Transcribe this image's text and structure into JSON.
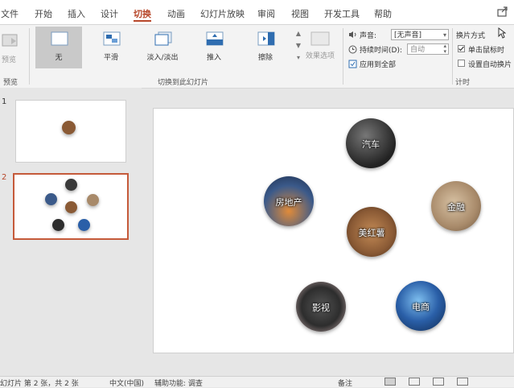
{
  "tabs": [
    "文件",
    "开始",
    "插入",
    "设计",
    "切换",
    "动画",
    "幻灯片放映",
    "审阅",
    "视图",
    "开发工具",
    "帮助"
  ],
  "active_tab": "切换",
  "ribbon": {
    "preview": {
      "label": "预览",
      "group": "预览"
    },
    "transitions": [
      "无",
      "平滑",
      "淡入/淡出",
      "推入",
      "擦除"
    ],
    "selected_transition": "无",
    "effect_options": "效果选项",
    "group_transitions": "切换到此幻灯片",
    "timing": {
      "sound_label": "声音:",
      "sound_value": "[无声音]",
      "duration_label": "持续时间(D):",
      "duration_value": "自动",
      "apply_all": "应用到全部",
      "advance_label": "换片方式",
      "on_click": "单击鼠标时",
      "auto_after": "设置自动换片",
      "group": "计时"
    }
  },
  "slides": [
    {
      "number": "1"
    },
    {
      "number": "2"
    }
  ],
  "canvas_circles": [
    {
      "label": "汽车",
      "color": "#3a3a3a"
    },
    {
      "label": "房地产",
      "color": "#3b5a8a"
    },
    {
      "label": "金融",
      "color": "#a88a6a"
    },
    {
      "label": "美红薯",
      "color": "#8a5a35"
    },
    {
      "label": "影视",
      "color": "#2d2d2d"
    },
    {
      "label": "电商",
      "color": "#2a5fa8"
    }
  ],
  "status": {
    "slide_info": "幻灯片 第 2 张，共 2 张",
    "language": "中文(中国)",
    "accessibility": "辅助功能: 调查",
    "notes": "备注"
  },
  "colors": {
    "accent": "#b7472a"
  }
}
